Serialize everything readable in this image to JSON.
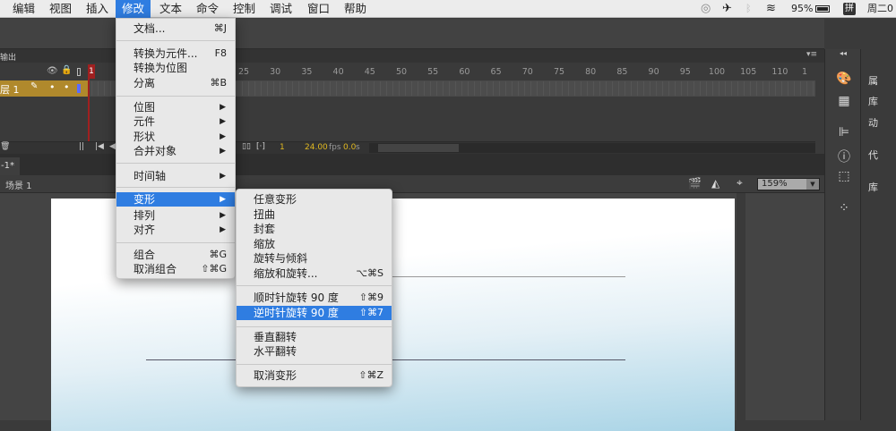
{
  "menubar": {
    "items": [
      "编辑",
      "视图",
      "插入",
      "修改",
      "文本",
      "命令",
      "控制",
      "调试",
      "窗口",
      "帮助"
    ],
    "active": "修改"
  },
  "status": {
    "battery": "95%",
    "input": "拼",
    "clock": "周二0"
  },
  "panel": {
    "tab": "输出"
  },
  "timeline": {
    "ruler": [
      "25",
      "30",
      "35",
      "40",
      "45",
      "50",
      "55",
      "60",
      "65",
      "70",
      "75",
      "80",
      "85",
      "90",
      "95",
      "100",
      "105",
      "110",
      "1"
    ],
    "playhead": "1",
    "layer": "层 1",
    "frame": "1",
    "fps": "24.00",
    "fps_unit": "fps",
    "time": "0.0",
    "time_unit": "s"
  },
  "document": {
    "tab": "-1*",
    "scene": "场景 1",
    "zoom": "159%"
  },
  "right_panels": [
    "属",
    "库",
    "动",
    "代",
    "库"
  ],
  "modify_menu": [
    {
      "label": "文档...",
      "shortcut": "⌘J"
    },
    {
      "label": "转换为元件...",
      "shortcut": "F8"
    },
    {
      "label": "转换为位图",
      "shortcut": ""
    },
    {
      "label": "分离",
      "shortcut": "⌘B"
    },
    {
      "label": "位图",
      "submenu": true
    },
    {
      "label": "元件",
      "submenu": true
    },
    {
      "label": "形状",
      "submenu": true
    },
    {
      "label": "合并对象",
      "submenu": true
    },
    {
      "label": "时间轴",
      "submenu": true
    },
    {
      "label": "变形",
      "submenu": true,
      "highlighted": true
    },
    {
      "label": "排列",
      "submenu": true
    },
    {
      "label": "对齐",
      "submenu": true
    },
    {
      "label": "组合",
      "shortcut": "⌘G"
    },
    {
      "label": "取消组合",
      "shortcut": "⇧⌘G"
    }
  ],
  "transform_menu": [
    {
      "label": "任意变形",
      "shortcut": ""
    },
    {
      "label": "扭曲",
      "shortcut": ""
    },
    {
      "label": "封套",
      "shortcut": ""
    },
    {
      "label": "缩放",
      "shortcut": ""
    },
    {
      "label": "旋转与倾斜",
      "shortcut": ""
    },
    {
      "label": "缩放和旋转...",
      "shortcut": "⌥⌘S"
    },
    {
      "label": "顺时针旋转 90 度",
      "shortcut": "⇧⌘9"
    },
    {
      "label": "逆时针旋转 90 度",
      "shortcut": "⇧⌘7",
      "highlighted": true
    },
    {
      "label": "垂直翻转",
      "shortcut": ""
    },
    {
      "label": "水平翻转",
      "shortcut": ""
    },
    {
      "label": "取消变形",
      "shortcut": "⇧⌘Z"
    }
  ]
}
